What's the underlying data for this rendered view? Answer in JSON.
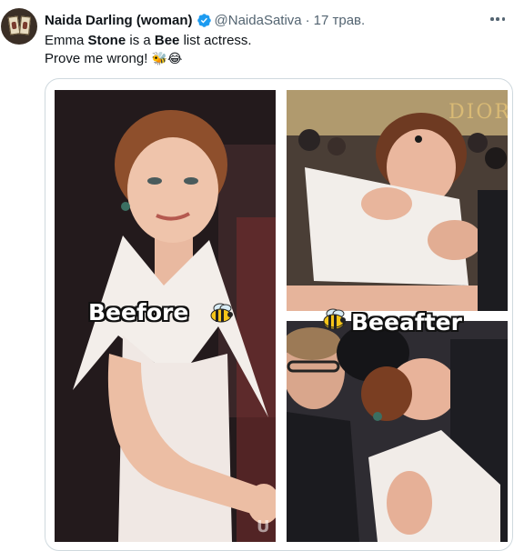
{
  "author": {
    "display_name": "Naida Darling (woman)",
    "handle": "@NaidaSativa",
    "separator": "·",
    "date": "17 трав.",
    "verified_icon": "verified-badge-icon"
  },
  "tweet": {
    "line1_prefix": "Emma ",
    "line1_bold1": "Stone",
    "line1_mid": " is a ",
    "line1_bold2": "Bee",
    "line1_suffix": " list actress.",
    "line2": "Prove me wrong! ",
    "line2_emojis": "🐝😂"
  },
  "media": {
    "caption_before": "Beefore",
    "caption_after": "Beeafter",
    "watermark": "U",
    "backdrop_text": "DIOR"
  },
  "colors": {
    "accent": "#1d9bf0",
    "text": "#0f1419",
    "secondary_text": "#536471",
    "border": "#cfd9de"
  }
}
